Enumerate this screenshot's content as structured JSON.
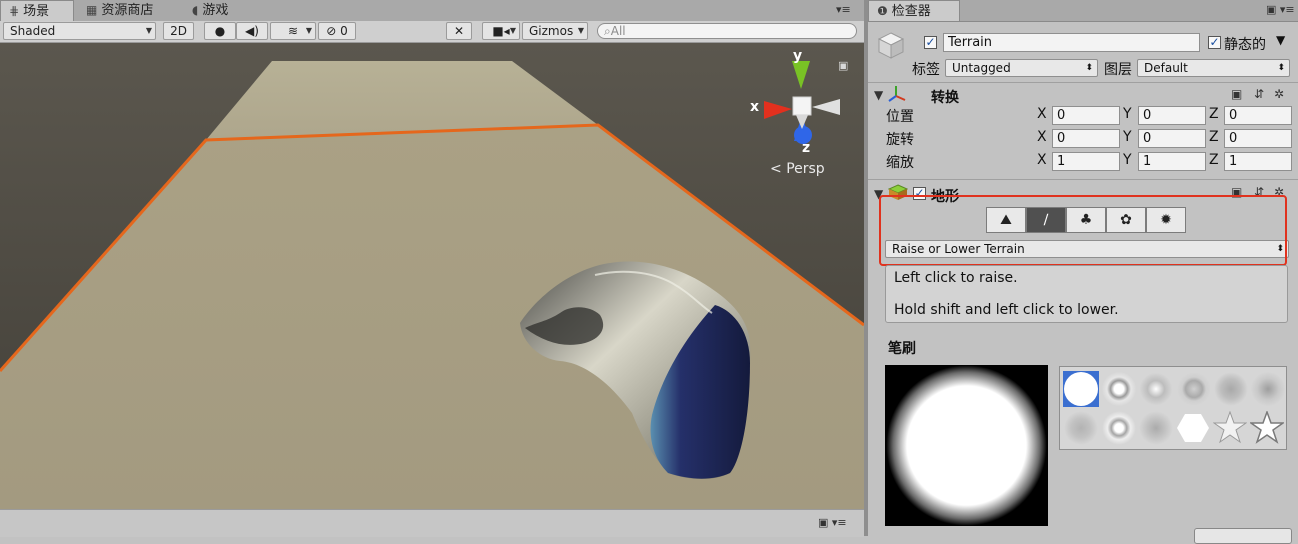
{
  "scene": {
    "tabs": [
      {
        "icon": "grid-icon",
        "label": "场景"
      },
      {
        "icon": "store-icon",
        "label": "资源商店"
      },
      {
        "icon": "gamepad-icon",
        "label": "游戏"
      }
    ],
    "toolbar": {
      "shading_mode": "Shaded",
      "mode_2d": "2D",
      "hidden_count": "0",
      "gizmos": "Gizmos",
      "search_placeholder": "All"
    },
    "gizmo": {
      "axis_y": "y",
      "axis_x": "x",
      "axis_z": "z",
      "projection": "Persp"
    },
    "accent_colors": {
      "selection_outline": "#e5671c",
      "gizmo_x": "#e2301e",
      "gizmo_y": "#79c225",
      "gizmo_z": "#2f66e8"
    }
  },
  "inspector": {
    "tab": {
      "icon": "info-icon",
      "label": "检查器"
    },
    "object": {
      "active": true,
      "name": "Terrain",
      "static_label": "静态的",
      "static": true,
      "tag_label": "标签",
      "tag_value": "Untagged",
      "layer_label": "图层",
      "layer_value": "Default"
    },
    "transform": {
      "title": "转换",
      "rows": [
        {
          "label": "位置",
          "x": "0",
          "y": "0",
          "z": "0"
        },
        {
          "label": "旋转",
          "x": "0",
          "y": "0",
          "z": "0"
        },
        {
          "label": "缩放",
          "x": "1",
          "y": "1",
          "z": "1"
        }
      ],
      "axis_x": "X",
      "axis_y": "Y",
      "axis_z": "Z"
    },
    "terrain": {
      "title": "地形",
      "enabled": true,
      "tools": [
        {
          "name": "raise-lower-tool",
          "icon": "mountain-icon",
          "selected": false
        },
        {
          "name": "paint-texture-tool",
          "icon": "brush-icon",
          "selected": true
        },
        {
          "name": "place-trees-tool",
          "icon": "tree-icon",
          "selected": false
        },
        {
          "name": "paint-details-tool",
          "icon": "flower-icon",
          "selected": false
        },
        {
          "name": "terrain-settings-tool",
          "icon": "gear-icon",
          "selected": false
        }
      ],
      "mode_value": "Raise or Lower Terrain",
      "help_line1": "Left click to raise.",
      "help_line2": "Hold shift and left click to lower.",
      "brush_label": "笔刷"
    },
    "highlight_color": "#e0321e"
  }
}
